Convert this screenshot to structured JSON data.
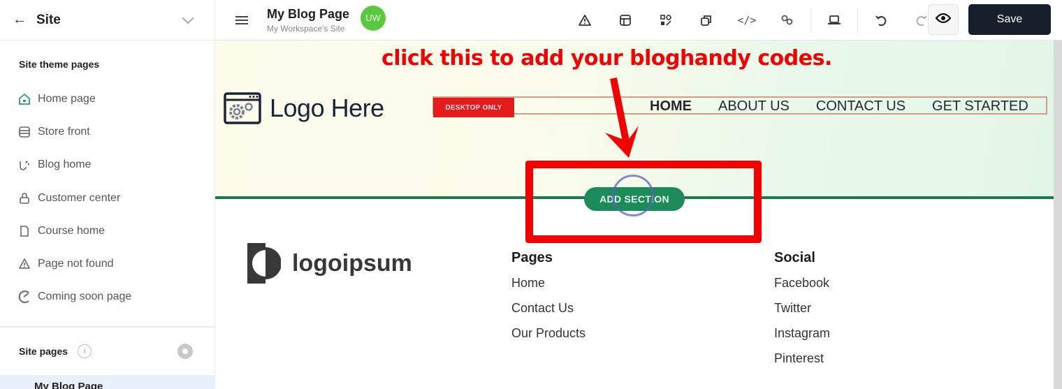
{
  "sidebar": {
    "title": "Site",
    "section_title": "Site theme pages",
    "items": [
      {
        "label": "Home page",
        "icon": "home-icon"
      },
      {
        "label": "Store front",
        "icon": "store-icon"
      },
      {
        "label": "Blog home",
        "icon": "blog-icon"
      },
      {
        "label": "Customer center",
        "icon": "lock-icon"
      },
      {
        "label": "Course home",
        "icon": "file-icon"
      },
      {
        "label": "Page not found",
        "icon": "warning-icon"
      },
      {
        "label": "Coming soon page",
        "icon": "rocket-icon"
      }
    ],
    "site_pages_label": "Site pages",
    "active_page": "My Blog Page"
  },
  "topbar": {
    "page_title": "My Blog Page",
    "workspace": "My Workspace's Site",
    "avatar_initials": "UW",
    "save_label": "Save"
  },
  "canvas": {
    "logo_text": "Logo Here",
    "desktop_badge": "DESKTOP ONLY",
    "nav": [
      "HOME",
      "ABOUT US",
      "CONTACT US",
      "GET STARTED"
    ],
    "add_section_label": "ADD SECTION",
    "annotation": "click this to add your bloghandy codes.",
    "footer_logo_text": "logoipsum",
    "pages_heading": "Pages",
    "pages_links": [
      "Home",
      "Contact Us",
      "Our Products"
    ],
    "social_heading": "Social",
    "social_links": [
      "Facebook",
      "Twitter",
      "Instagram",
      "Pinterest"
    ]
  },
  "colors": {
    "accent_green": "#1d8a5a",
    "annotation_red": "#f40000",
    "save_bg": "#171e2c",
    "avatar_bg": "#5ac93f"
  }
}
